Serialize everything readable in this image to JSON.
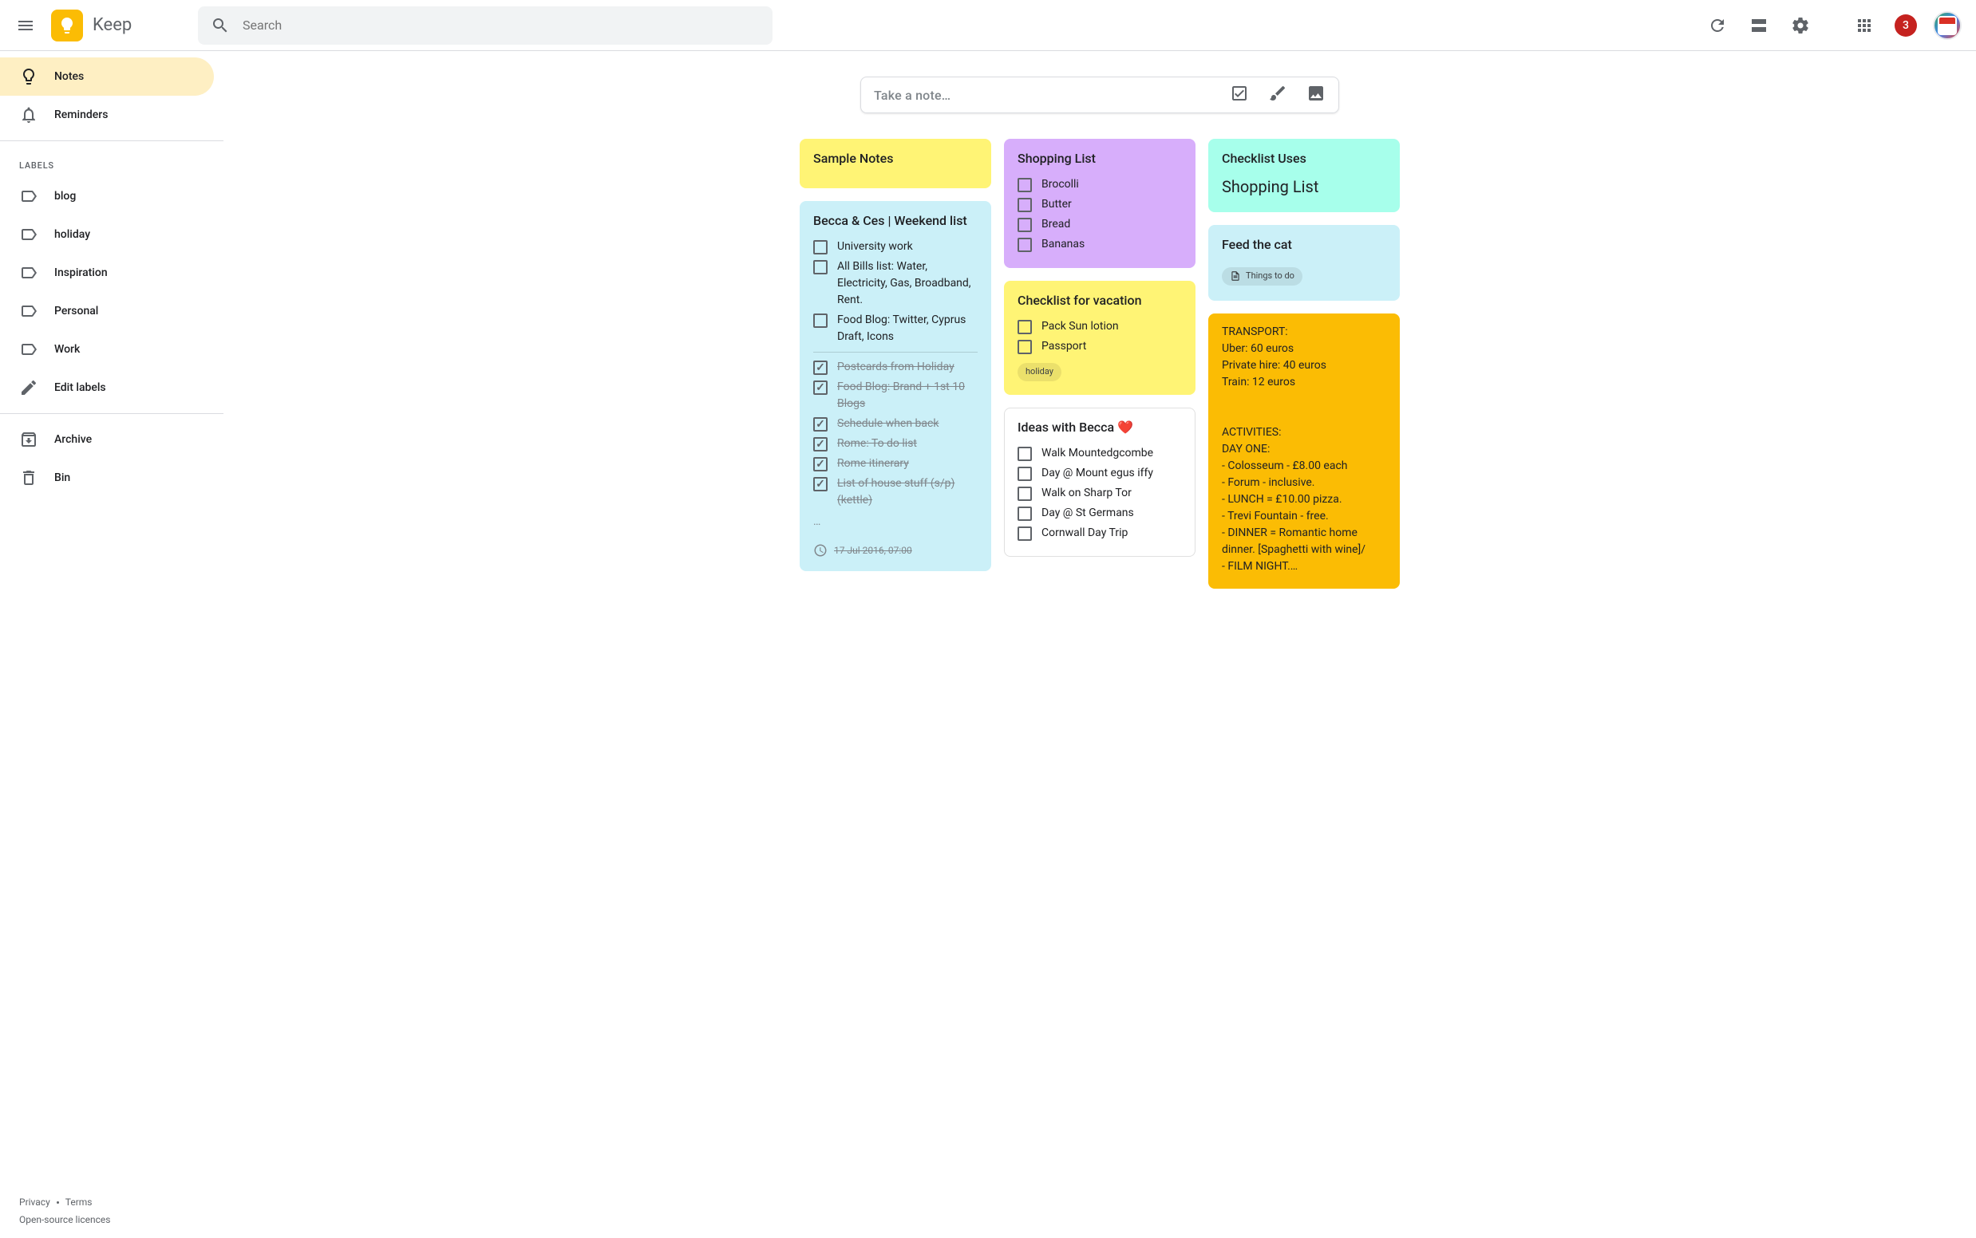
{
  "header": {
    "app_name": "Keep",
    "search_placeholder": "Search",
    "notifications_count": "3"
  },
  "sidebar": {
    "primary": [
      {
        "icon": "bulb",
        "label": "Notes",
        "active": true
      },
      {
        "icon": "bell",
        "label": "Reminders",
        "active": false
      }
    ],
    "labels_heading": "LABELS",
    "labels": [
      {
        "label": "blog"
      },
      {
        "label": "holiday"
      },
      {
        "label": "Inspiration"
      },
      {
        "label": "Personal"
      },
      {
        "label": "Work"
      }
    ],
    "edit_labels": "Edit labels",
    "secondary": [
      {
        "icon": "archive",
        "label": "Archive"
      },
      {
        "icon": "bin",
        "label": "Bin"
      }
    ]
  },
  "footer": {
    "privacy": "Privacy",
    "terms": "Terms",
    "licences": "Open-source licences"
  },
  "take_note_placeholder": "Take a note…",
  "columns": [
    [
      {
        "id": "sample",
        "color": "yellow",
        "title": "Sample Notes",
        "body": ""
      },
      {
        "id": "weekend",
        "color": "blue",
        "title": "Becca & Ces | Weekend list",
        "checklist": {
          "unchecked": [
            "University work",
            "All Bills list: Water, Electricity, Gas, Broadband, Rent.",
            "Food Blog: Twitter, Cyprus Draft, Icons"
          ],
          "checked": [
            "Postcards from Holiday",
            "Food Blog: Brand + 1st 10 Blogs",
            "Schedule when back",
            "Rome: To do list",
            "Rome itinerary",
            "List of house stuff (s/p) (kettle)"
          ],
          "more": "…"
        },
        "reminder": "17 Jul 2016, 07:00"
      }
    ],
    [
      {
        "id": "shopping",
        "color": "purple",
        "title": "Shopping List",
        "checklist": {
          "unchecked": [
            "Brocolli",
            "Butter",
            "Bread",
            "Bananas"
          ]
        }
      },
      {
        "id": "vacation",
        "color": "yellow",
        "title": "Checklist for vacation",
        "checklist": {
          "unchecked": [
            "Pack Sun lotion",
            "Passport"
          ]
        },
        "chips": [
          {
            "type": "label",
            "text": "holiday"
          }
        ]
      },
      {
        "id": "ideas",
        "color": "white",
        "title": "Ideas with Becca ❤️",
        "checklist": {
          "unchecked": [
            "Walk Mountedgcombe",
            "Day @ Mount egus iffy",
            "Walk on Sharp Tor",
            "Day @ St Germans",
            "Cornwall Day Trip"
          ]
        }
      }
    ],
    [
      {
        "id": "uses",
        "color": "teal",
        "title": "Checklist Uses",
        "big_body": "Shopping List"
      },
      {
        "id": "feedcat",
        "color": "blue",
        "title": "Feed the cat",
        "chips": [
          {
            "type": "doc",
            "text": "Things to do"
          }
        ]
      },
      {
        "id": "transport",
        "color": "orange",
        "body_lines": [
          "TRANSPORT:",
          "Uber: 60 euros",
          "Private hire: 40 euros",
          "Train: 12 euros",
          "",
          "",
          "ACTIVITIES:",
          "DAY ONE:",
          "- Colosseum - £8.00 each",
          "- Forum - inclusive.",
          "- LUNCH = £10.00 pizza.",
          "- Trevi Fountain - free.",
          "- DINNER = Romantic home dinner. [Spaghetti with wine]/",
          "- FILM NIGHT.…"
        ]
      }
    ]
  ]
}
